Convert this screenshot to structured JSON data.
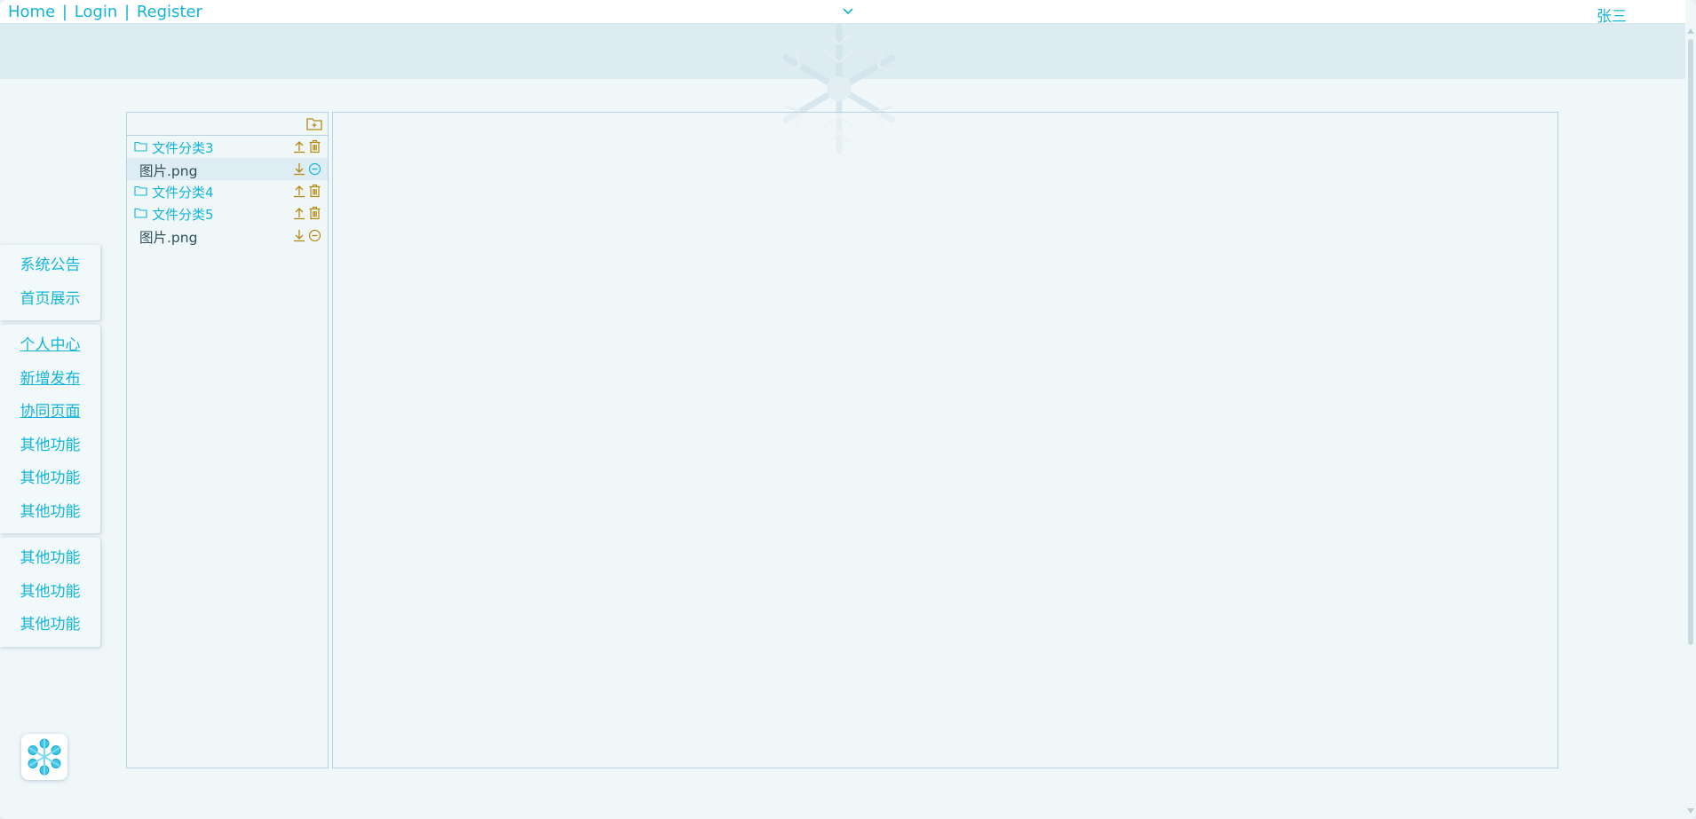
{
  "nav": {
    "home": "Home",
    "sep1": "|",
    "login": "Login",
    "sep2": "|",
    "register": "Register"
  },
  "user": {
    "name": "张三"
  },
  "sidemenu": {
    "group1": [
      "系统公告",
      "首页展示"
    ],
    "group2": [
      "个人中心",
      "新增发布",
      "协同页面",
      "其他功能",
      "其他功能",
      "其他功能"
    ],
    "group3": [
      "其他功能",
      "其他功能",
      "其他功能"
    ]
  },
  "files": {
    "tree": [
      {
        "type": "folder",
        "label": "文件分类3"
      },
      {
        "type": "file",
        "label": "图片.png",
        "selected": true
      },
      {
        "type": "folder",
        "label": "文件分类4"
      },
      {
        "type": "folder",
        "label": "文件分类5"
      },
      {
        "type": "file",
        "label": "图片.png"
      }
    ]
  },
  "colors": {
    "accent": "#12b5d8",
    "icon_gold": "#b38a12",
    "background": "#f0f7f9",
    "band": "#ddecf1"
  },
  "icons": {
    "new_folder": "folder-plus-icon",
    "upload": "upload-icon",
    "trash": "trash-icon",
    "download": "download-icon",
    "remove": "minus-circle-icon",
    "chevron": "chevron-down-icon",
    "logo": "snowflake-logo-icon"
  }
}
